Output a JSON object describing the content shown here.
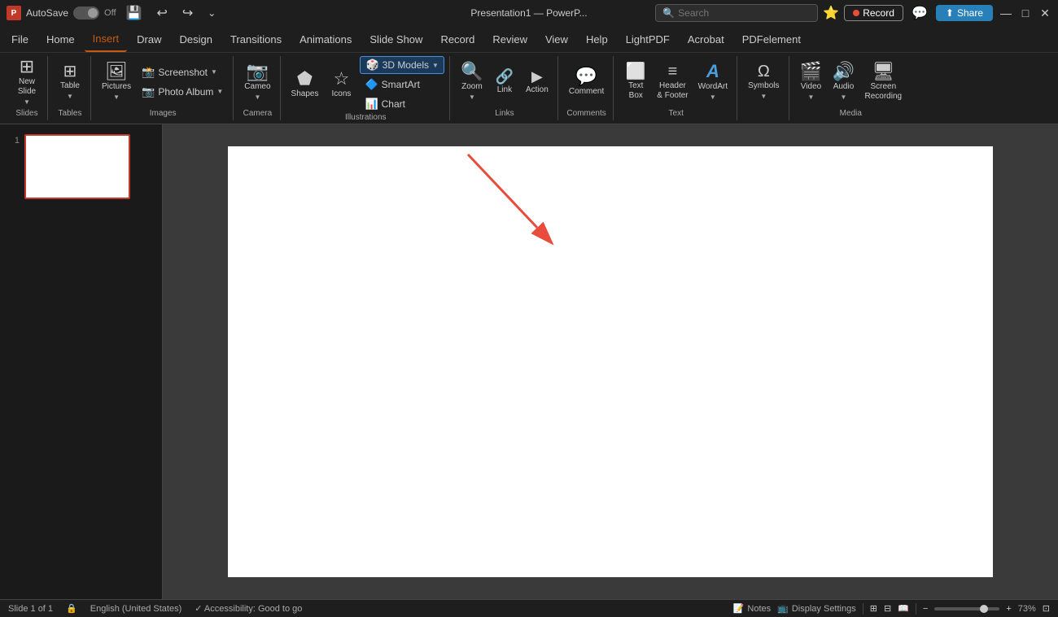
{
  "titleBar": {
    "appIcon": "P",
    "autosave": "AutoSave",
    "toggleState": "Off",
    "saveIcon": "💾",
    "undoIcon": "↩",
    "redoIcon": "↪",
    "customizeIcon": "⌄",
    "title": "Presentation1 — PowerP...",
    "searchPlaceholder": "Search",
    "recordLabel": "Record",
    "shareLabel": "Share",
    "minimizeIcon": "—",
    "maximizeIcon": "□",
    "closeIcon": "✕",
    "microsoftIcon": "⭐"
  },
  "ribbon": {
    "tabs": [
      {
        "label": "File",
        "active": false
      },
      {
        "label": "Home",
        "active": false
      },
      {
        "label": "Insert",
        "active": true
      },
      {
        "label": "Draw",
        "active": false
      },
      {
        "label": "Design",
        "active": false
      },
      {
        "label": "Transitions",
        "active": false
      },
      {
        "label": "Animations",
        "active": false
      },
      {
        "label": "Slide Show",
        "active": false
      },
      {
        "label": "Record",
        "active": false
      },
      {
        "label": "Review",
        "active": false
      },
      {
        "label": "View",
        "active": false
      },
      {
        "label": "Help",
        "active": false
      },
      {
        "label": "LightPDF",
        "active": false
      },
      {
        "label": "Acrobat",
        "active": false
      },
      {
        "label": "PDFelement",
        "active": false
      }
    ],
    "groups": {
      "slides": {
        "label": "Slides",
        "newSlide": "New\nSlide",
        "newSlideIcon": "⊞"
      },
      "tables": {
        "label": "Tables",
        "table": "Table",
        "tableIcon": "⊞"
      },
      "images": {
        "label": "Images",
        "pictures": "Pictures",
        "picturesIcon": "🖼",
        "screenshot": "Screenshot",
        "photoAlbum": "Photo Album"
      },
      "camera": {
        "label": "Camera",
        "cameo": "Cameo",
        "cameoIcon": "📷"
      },
      "illustrations": {
        "label": "Illustrations",
        "models3d": "3D Models",
        "shapes": "Shapes",
        "icons": "Icons",
        "smartArt": "SmartArt",
        "chart": "Chart",
        "shapesIcon": "⬟",
        "iconsIcon": "☆"
      },
      "links": {
        "label": "Links",
        "zoom": "Zoom",
        "link": "Link",
        "action": "Action"
      },
      "comments": {
        "label": "Comments",
        "comment": "Comment"
      },
      "text": {
        "label": "Text",
        "textBox": "Text\nBox",
        "header": "Header\n& Footer",
        "wordArt": "WordArt",
        "textBoxIcon": "⬜",
        "headerIcon": "≡",
        "wordArtIcon": "A"
      },
      "symbols": {
        "label": "",
        "symbols": "Symbols"
      },
      "media": {
        "label": "Media",
        "video": "Video",
        "audio": "Audio",
        "screenRecording": "Screen\nRecording"
      }
    }
  },
  "slidePanel": {
    "slides": [
      {
        "number": "1"
      }
    ]
  },
  "statusBar": {
    "slideInfo": "Slide 1 of 1",
    "language": "English (United States)",
    "accessibility": "Accessibility: Good to go",
    "notes": "Notes",
    "displaySettings": "Display Settings",
    "zoomLevel": "73%",
    "normalViewIcon": "⊞",
    "slideSorterIcon": "⊟",
    "readingViewIcon": "📖",
    "zoomInIcon": "+",
    "zoomOutIcon": "−",
    "fitToWindowIcon": "⊡"
  }
}
